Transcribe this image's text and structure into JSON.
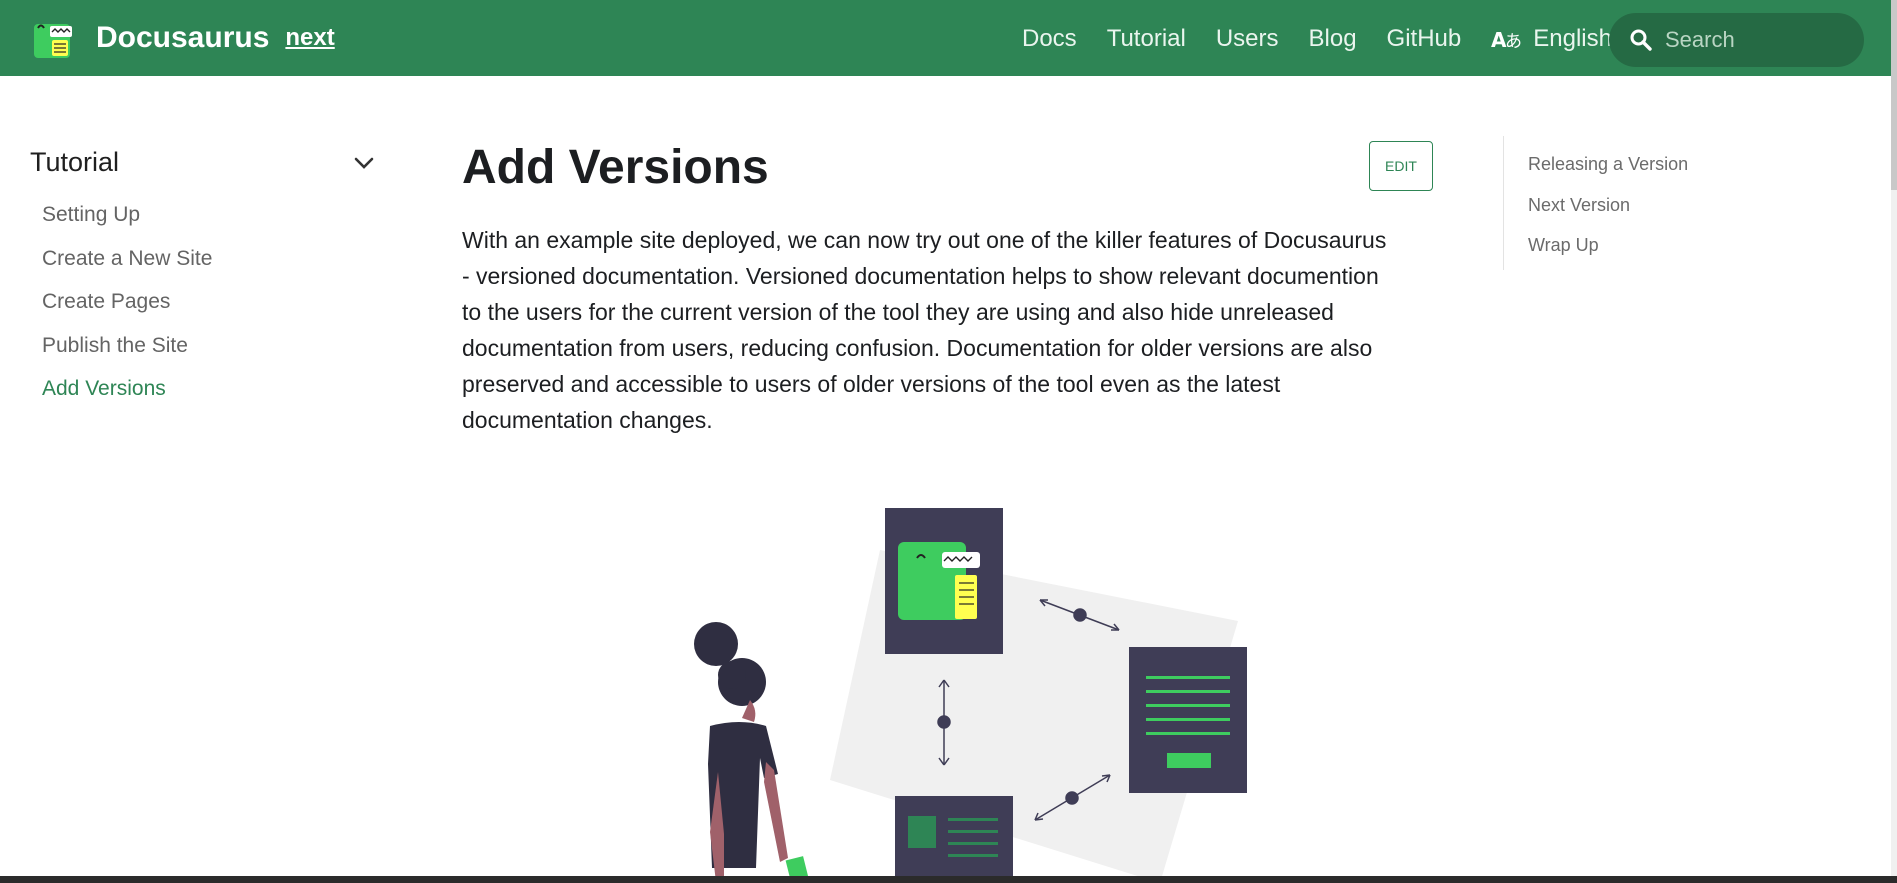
{
  "header": {
    "brand": "Docusaurus",
    "version": "next",
    "nav": [
      "Docs",
      "Tutorial",
      "Users",
      "Blog",
      "GitHub"
    ],
    "language": "English",
    "search_placeholder": "Search"
  },
  "sidebar": {
    "category": "Tutorial",
    "items": [
      "Setting Up",
      "Create a New Site",
      "Create Pages",
      "Publish the Site",
      "Add Versions"
    ],
    "active": "Add Versions"
  },
  "main": {
    "title": "Add Versions",
    "edit_label": "EDIT",
    "paragraph_lines": [
      "With an example site deployed, we can now try out one of the killer features of Docusaurus",
      "- versioned documentation. Versioned documentation helps to show relevant documention",
      "to the users for the current version of the tool they are using and also hide unreleased",
      "documentation from users, reducing confusion. Documentation for older versions are also",
      "preserved and accessible to users of older versions of the tool even as the latest",
      "documentation changes."
    ]
  },
  "toc": {
    "items": [
      "Releasing a Version",
      "Next Version",
      "Wrap Up"
    ]
  },
  "colors": {
    "primary": "#2e8555",
    "primary_dark": "#256a44",
    "illustration_dark": "#3f3d56",
    "illustration_green": "#3ecc5f"
  },
  "icons": {
    "logo": "docusaurus-dino-logo",
    "language": "translate-icon",
    "search": "search-icon",
    "sidebar_toggle": "chevron-down-icon"
  }
}
